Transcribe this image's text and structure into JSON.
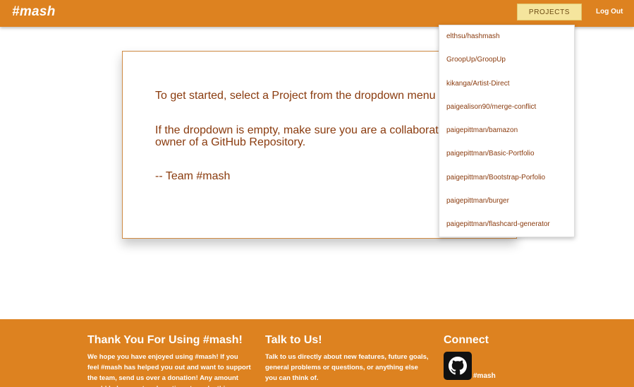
{
  "navbar": {
    "brand": "#mash",
    "projects_label": "PROJECTS",
    "logout_label": "Log Out"
  },
  "dropdown": {
    "items": [
      "elthsu/hashmash",
      "GroopUp/GroopUp",
      "kikanga/Artist-Direct",
      "paigealison90/merge-conflict",
      "paigepittman/bamazon",
      "paigepittman/Basic-Portfolio",
      "paigepittman/Bootstrap-Porfolio",
      "paigepittman/burger",
      "paigepittman/flashcard-generator"
    ]
  },
  "card": {
    "line1": "To get started, select a Project from the dropdown menu",
    "line2a": "If the dropdown is empty, make sure you are a collaborator or",
    "line2b": "owner of a GitHub Repository.",
    "signature": "-- Team #mash"
  },
  "footer": {
    "col1": {
      "title": "Thank You For Using #mash!",
      "text": "We hope you have enjoyed using #mash! If you feel #mash has helped you out and want to support the team, send us over a donation! Any amount would help us out and continue to make this"
    },
    "col2": {
      "title": "Talk to Us!",
      "text": "Talk to us directly about new features, future goals, general problems or questions, or anything else you can think of."
    },
    "col3": {
      "title": "Connect",
      "github_label": "#mash",
      "icon": "github-icon"
    }
  },
  "colors": {
    "primary": "#dd8220",
    "button_bg": "#f5e59d",
    "text_brown": "#8a3b0e"
  }
}
